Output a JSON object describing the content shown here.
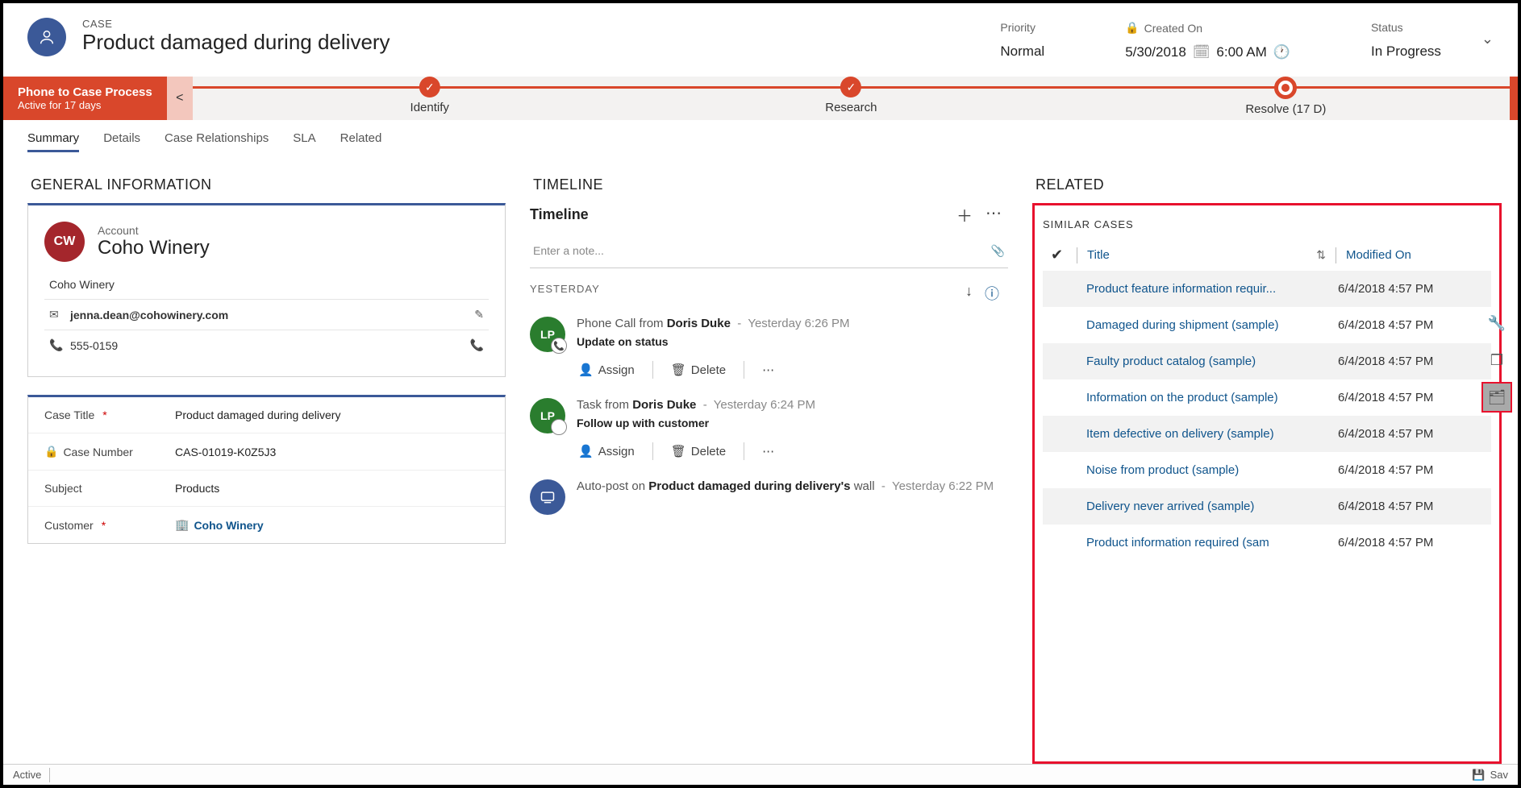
{
  "header": {
    "entity_label": "CASE",
    "title": "Product damaged during delivery",
    "fields": {
      "priority_label": "Priority",
      "priority_value": "Normal",
      "created_label": "Created On",
      "created_date": "5/30/2018",
      "created_time": "6:00 AM",
      "status_label": "Status",
      "status_value": "In Progress"
    }
  },
  "process": {
    "name": "Phone to Case Process",
    "sub": "Active for 17 days",
    "stages": {
      "identify": "Identify",
      "research": "Research",
      "resolve": "Resolve  (17 D)"
    }
  },
  "tabs": {
    "summary": "Summary",
    "details": "Details",
    "case_rel": "Case Relationships",
    "sla": "SLA",
    "related": "Related"
  },
  "general": {
    "heading": "GENERAL INFORMATION",
    "account_label": "Account",
    "account_name": "Coho Winery",
    "account_initials": "CW",
    "company": "Coho Winery",
    "email": "jenna.dean@cohowinery.com",
    "phone": "555-0159",
    "fields": {
      "case_title_label": "Case Title",
      "case_title_value": "Product damaged during delivery",
      "case_number_label": "Case Number",
      "case_number_value": "CAS-01019-K0Z5J3",
      "subject_label": "Subject",
      "subject_value": "Products",
      "customer_label": "Customer",
      "customer_value": "Coho Winery"
    }
  },
  "timeline": {
    "heading": "TIMELINE",
    "title": "Timeline",
    "note_placeholder": "Enter a note...",
    "section_yesterday": "YESTERDAY",
    "avatar_initials": "LP",
    "assign_label": "Assign",
    "delete_label": "Delete",
    "items": [
      {
        "prefix": "Phone Call from ",
        "who": "Doris Duke",
        "when": "Yesterday 6:26 PM",
        "subject": "Update on status"
      },
      {
        "prefix": "Task from ",
        "who": "Doris Duke",
        "when": "Yesterday 6:24 PM",
        "subject": "Follow up with customer"
      }
    ],
    "autopost": {
      "prefix": "Auto-post on ",
      "who": "Product damaged during delivery's",
      "suffix": " wall",
      "when": "Yesterday 6:22 PM"
    }
  },
  "related": {
    "heading": "RELATED",
    "sub": "SIMILAR CASES",
    "col_title": "Title",
    "col_mod": "Modified On",
    "rows": [
      {
        "title": "Product feature information requir...",
        "mod": "6/4/2018 4:57 PM"
      },
      {
        "title": "Damaged during shipment (sample)",
        "mod": "6/4/2018 4:57 PM"
      },
      {
        "title": "Faulty product catalog (sample)",
        "mod": "6/4/2018 4:57 PM"
      },
      {
        "title": "Information on the product (sample)",
        "mod": "6/4/2018 4:57 PM"
      },
      {
        "title": "Item defective on delivery (sample)",
        "mod": "6/4/2018 4:57 PM"
      },
      {
        "title": "Noise from product (sample)",
        "mod": "6/4/2018 4:57 PM"
      },
      {
        "title": "Delivery never arrived (sample)",
        "mod": "6/4/2018 4:57 PM"
      },
      {
        "title": "Product information required (sam",
        "mod": "6/4/2018 4:57 PM"
      }
    ]
  },
  "statusbar": {
    "state": "Active",
    "save": "Sav"
  }
}
